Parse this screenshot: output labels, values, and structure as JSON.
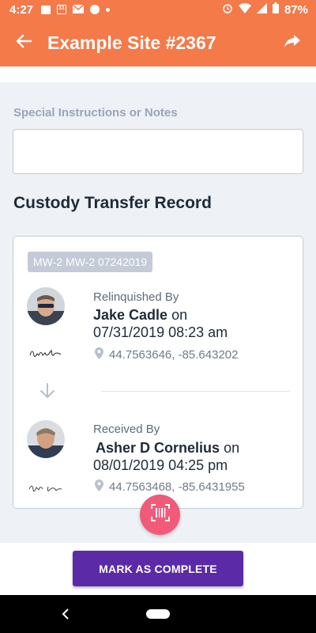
{
  "status_bar": {
    "time": "4:27",
    "calendar_day": "31",
    "battery": "87%"
  },
  "header": {
    "title": "Example Site #2367",
    "back_icon": "arrow-left-icon",
    "share_icon": "share-icon"
  },
  "notes": {
    "label": "Special Instructions or Notes",
    "value": "",
    "placeholder": ""
  },
  "custody": {
    "title": "Custody Transfer Record",
    "tag": "MW-2 MW-2 07242019",
    "relinquished": {
      "role": "Relinquished By",
      "name": "Jake Cadle",
      "on_word": "on",
      "datetime": "07/31/2019 08:23 am",
      "coords": "44.7563646, -85.643202"
    },
    "received": {
      "role": "Received By",
      "name": "Asher D Cornelius",
      "on_word": "on",
      "datetime": "08/01/2019 04:25 pm",
      "coords": "44.7563468, -85.6431955"
    }
  },
  "actions": {
    "complete_label": "MARK AS COMPLETE",
    "scan_icon": "barcode-scan-icon"
  },
  "colors": {
    "header": "#f47a4a",
    "primary_button": "#5b2aa6",
    "fab": "#f25a7a"
  }
}
